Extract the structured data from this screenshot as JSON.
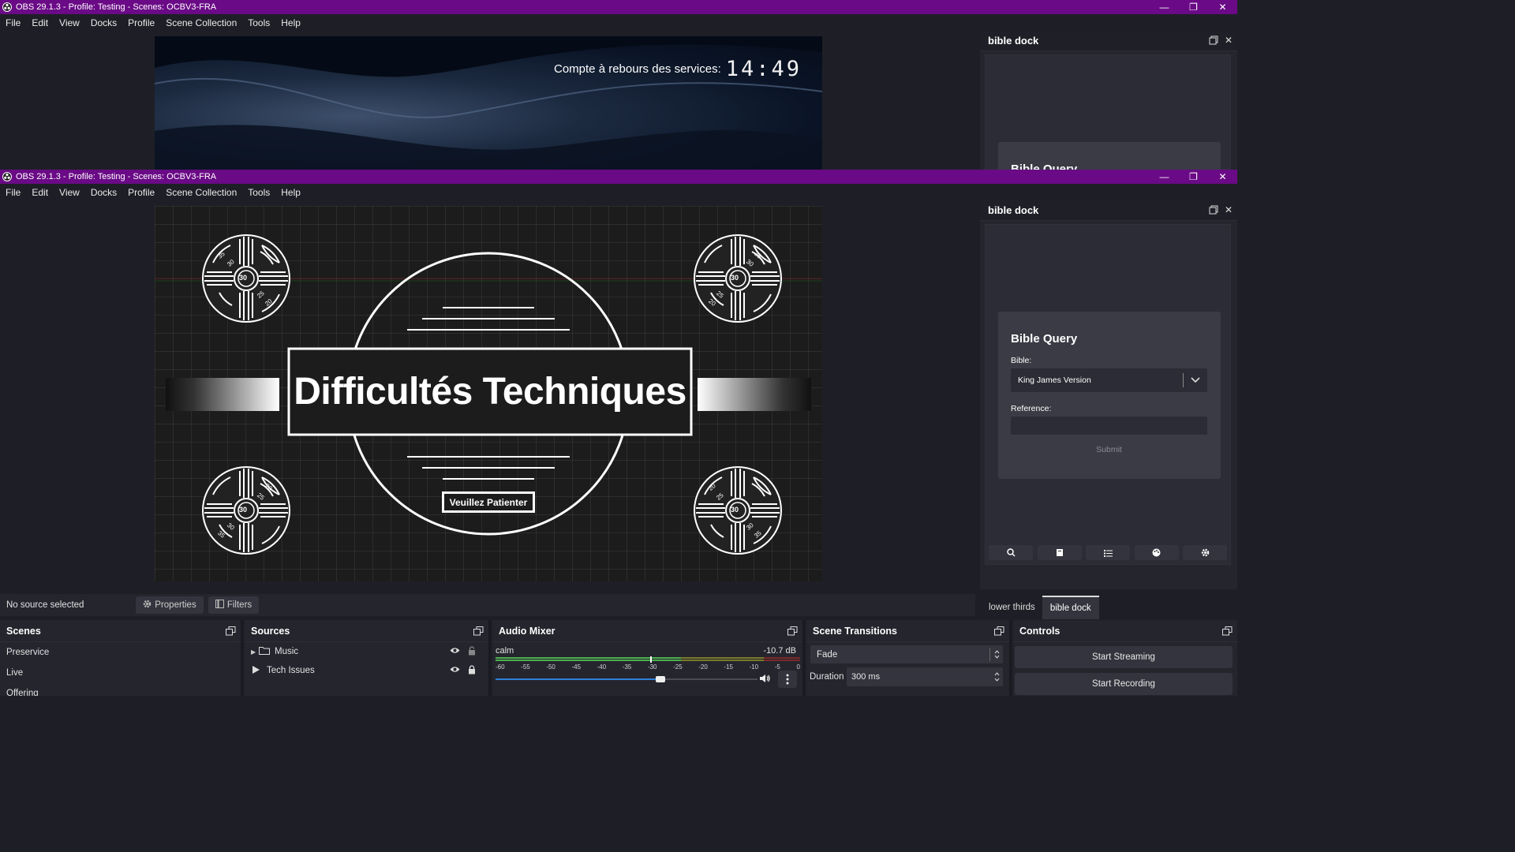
{
  "window": {
    "title": "OBS 29.1.3 - Profile: Testing - Scenes: OCBV3-FRA",
    "controls": {
      "minimize": "—",
      "maximize": "❐",
      "close": "✕"
    }
  },
  "menu": [
    "File",
    "Edit",
    "View",
    "Docks",
    "Profile",
    "Scene Collection",
    "Tools",
    "Help"
  ],
  "countdown": {
    "label": "Compte à rebours des services:",
    "time": "14:49"
  },
  "preview": {
    "title": "Difficultés Techniques",
    "button": "Veuillez Patienter",
    "dial": {
      "center": "30",
      "marks": [
        "20",
        "25",
        "30",
        "35"
      ]
    }
  },
  "bible_dock": {
    "title": "bible dock",
    "query_title": "Bible Query",
    "bible_label": "Bible:",
    "bible_value": "King James Version",
    "reference_label": "Reference:",
    "reference_value": "",
    "submit": "Submit",
    "tabs": [
      "lower thirds",
      "bible dock"
    ],
    "active_tab": "bible dock"
  },
  "bottom_bar": {
    "status": "No source selected",
    "properties": "Properties",
    "filters": "Filters"
  },
  "scenes": {
    "title": "Scenes",
    "items": [
      "Preservice",
      "Live",
      "Offering"
    ]
  },
  "sources": {
    "title": "Sources",
    "items": [
      {
        "name": "Music",
        "type": "group"
      },
      {
        "name": "Tech Issues",
        "type": "media"
      }
    ]
  },
  "audio_mixer": {
    "title": "Audio Mixer",
    "channel": "calm",
    "level": "-10.7 dB",
    "ticks": [
      "-60",
      "-55",
      "-50",
      "-45",
      "-40",
      "-35",
      "-30",
      "-25",
      "-20",
      "-15",
      "-10",
      "-5",
      "0"
    ],
    "volume_fraction": 0.63
  },
  "scene_transitions": {
    "title": "Scene Transitions",
    "transition": "Fade",
    "duration_label": "Duration",
    "duration": "300 ms"
  },
  "controls": {
    "title": "Controls",
    "start_streaming": "Start Streaming",
    "start_recording": "Start Recording"
  },
  "colors": {
    "titlebar": "#6a0a86",
    "background": "#1e1f26",
    "meter_green": "#4caf50",
    "meter_yellow": "#c8b400",
    "meter_red": "#c0392b"
  }
}
